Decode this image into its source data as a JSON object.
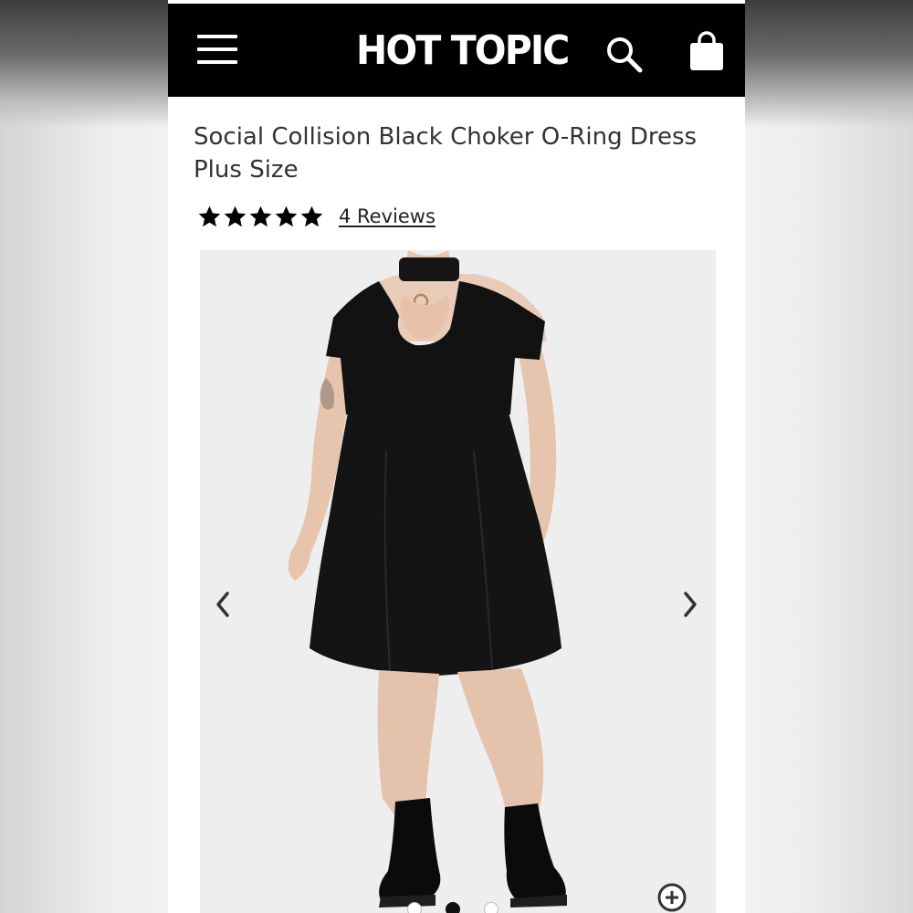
{
  "header": {
    "logo_text": "HOT TOPIC",
    "background": "#000000",
    "icons": [
      "menu-icon",
      "search-icon",
      "shopping-bag-icon"
    ]
  },
  "product": {
    "title": "Social Collision Black Choker O-Ring Dress Plus Size",
    "rating_stars": 5,
    "rating_max": 5,
    "reviews_label": "4 Reviews"
  },
  "gallery": {
    "image_subject": "model wearing black choker o-ring dress with combat boots",
    "active_image": 2,
    "image_count": 3,
    "icons": [
      "chevron-left-icon",
      "chevron-right-icon",
      "zoom-in-icon"
    ]
  },
  "colors": {
    "text": "#333333",
    "star": "#000000",
    "gallery_bg": "#eeeeef"
  }
}
